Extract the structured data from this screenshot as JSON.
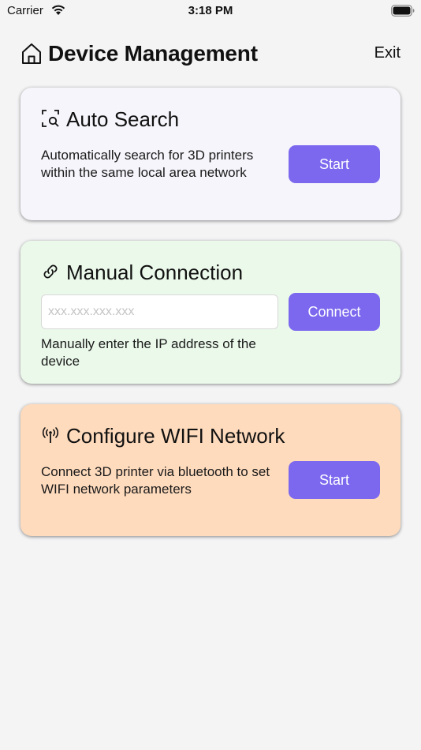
{
  "status_bar": {
    "carrier": "Carrier",
    "time": "3:18 PM"
  },
  "header": {
    "title": "Device Management",
    "exit_label": "Exit"
  },
  "auto_search": {
    "title": "Auto Search",
    "description": "Automatically search for 3D printers within the same local area network",
    "button_label": "Start"
  },
  "manual_connection": {
    "title": "Manual Connection",
    "ip_placeholder": "xxx.xxx.xxx.xxx",
    "ip_value": "",
    "description": "Manually enter the IP address of the device",
    "button_label": "Connect"
  },
  "wifi_config": {
    "title": "Configure WIFI Network",
    "description": "Connect 3D printer via bluetooth to set WIFI network parameters",
    "button_label": "Start"
  },
  "icons": {
    "home": "home-icon",
    "auto_search": "scan-search-icon",
    "manual": "link-icon",
    "wifi": "antenna-icon"
  },
  "colors": {
    "accent": "#7b68ee",
    "auto_card_bg": "#f5f5fb",
    "manual_card_bg": "#ebf9eb",
    "wifi_card_bg": "#ffdbbd"
  }
}
